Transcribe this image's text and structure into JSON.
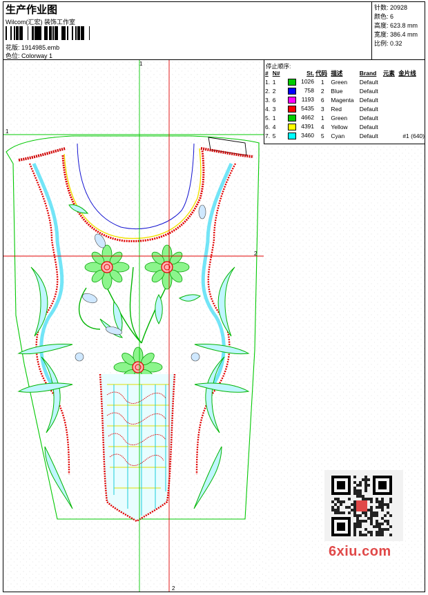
{
  "header": {
    "title": "生产作业图",
    "company": "Wilcom(汇宏) 装饰工作室",
    "design_label": "花版:",
    "design_file": "1914985.emb",
    "colorway_label": "色位:",
    "colorway": "Colorway 1"
  },
  "stats": [
    {
      "label": "针数:",
      "value": "20928"
    },
    {
      "label": "颜色:",
      "value": "6"
    },
    {
      "label": "高度:",
      "value": "623.8 mm"
    },
    {
      "label": "宽度:",
      "value": "386.4 mm"
    },
    {
      "label": "比例:",
      "value": "0.32"
    }
  ],
  "guides": {
    "v1": "1",
    "h1": "1",
    "h2": "2",
    "v2": "2"
  },
  "sequence": {
    "caption": "停止顺序:",
    "headers": [
      "#",
      "N#",
      "St.",
      "代码",
      "描述",
      "Brand",
      "元素",
      "金片线"
    ],
    "rows": [
      {
        "idx": "1.",
        "n": "1",
        "color": "#00cc00",
        "st": "1026",
        "code": "1",
        "desc": "Green",
        "brand": "Default",
        "elem": "",
        "seq": ""
      },
      {
        "idx": "2.",
        "n": "2",
        "color": "#0000ff",
        "st": "758",
        "code": "2",
        "desc": "Blue",
        "brand": "Default",
        "elem": "",
        "seq": ""
      },
      {
        "idx": "3.",
        "n": "6",
        "color": "#ff00ff",
        "st": "1193",
        "code": "6",
        "desc": "Magenta",
        "brand": "Default",
        "elem": "",
        "seq": ""
      },
      {
        "idx": "4.",
        "n": "3",
        "color": "#ff0000",
        "st": "5435",
        "code": "3",
        "desc": "Red",
        "brand": "Default",
        "elem": "",
        "seq": ""
      },
      {
        "idx": "5.",
        "n": "1",
        "color": "#00cc00",
        "st": "4662",
        "code": "1",
        "desc": "Green",
        "brand": "Default",
        "elem": "",
        "seq": ""
      },
      {
        "idx": "6.",
        "n": "4",
        "color": "#ffff00",
        "st": "4391",
        "code": "4",
        "desc": "Yellow",
        "brand": "Default",
        "elem": "",
        "seq": ""
      },
      {
        "idx": "7.",
        "n": "5",
        "color": "#00ffff",
        "st": "3460",
        "code": "5",
        "desc": "Cyan",
        "brand": "Default",
        "elem": "",
        "seq": "#1 (640)"
      }
    ]
  },
  "watermark": {
    "logo_text": "6xiu.com"
  }
}
